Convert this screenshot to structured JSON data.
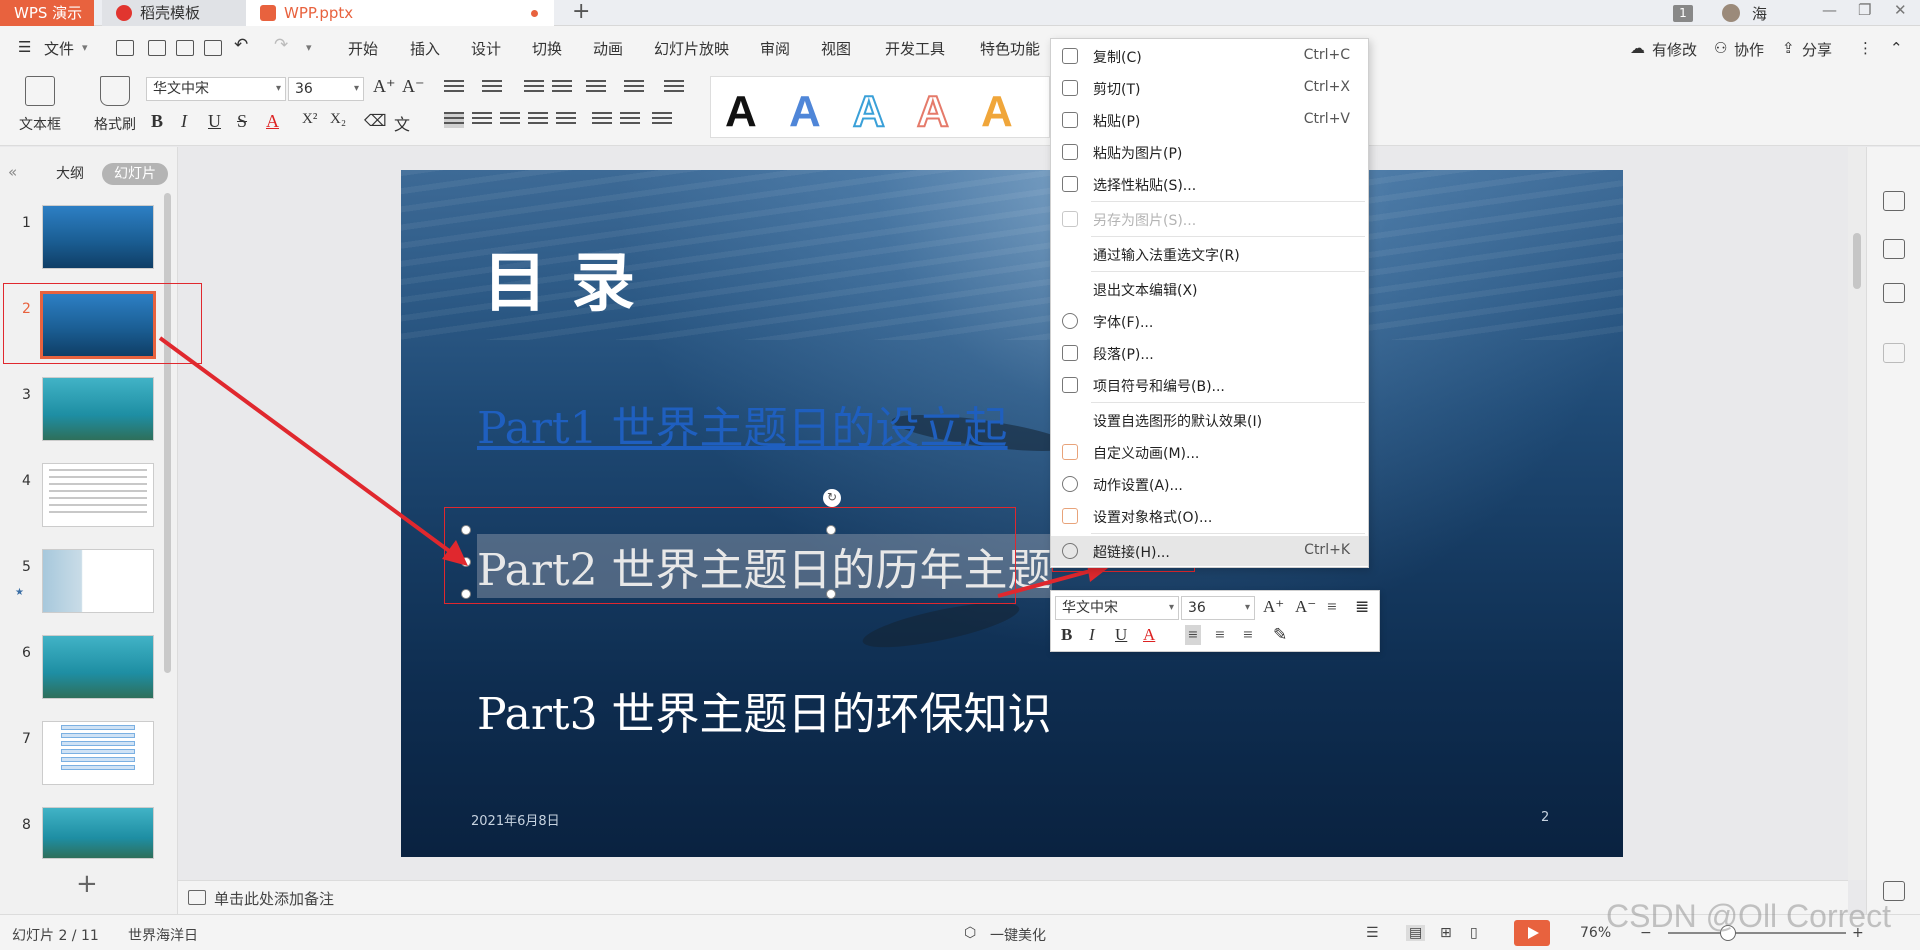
{
  "tabs": {
    "app": "WPS 演示",
    "docer": "稻壳模板",
    "file": "WPP.pptx",
    "add": "+",
    "badge": "1",
    "user": "海"
  },
  "menu": {
    "file": "文件",
    "items": [
      "开始",
      "插入",
      "设计",
      "切换",
      "动画",
      "幻灯片放映",
      "审阅",
      "视图",
      "开发工具",
      "特色功能"
    ],
    "right": [
      "有修改",
      "协作",
      "分享"
    ]
  },
  "ribbon": {
    "textbox": "文本框",
    "format_painter": "格式刷",
    "font": "华文中宋",
    "size": "36",
    "style_letter": "A"
  },
  "left_panel": {
    "tab_outline": "大纲",
    "tab_slides": "幻灯片",
    "slide_numbers": [
      "1",
      "2",
      "3",
      "4",
      "5",
      "6",
      "7",
      "8"
    ],
    "add": "+"
  },
  "slide": {
    "title": "目录",
    "part1": "Part1   世界主题日的设立起",
    "part2": "Part2   世界主题日的历年主题",
    "part3": "Part3   世界主题日的环保知识",
    "date": "2021年6月8日",
    "page": "2"
  },
  "context_menu": [
    {
      "label": "复制(C)",
      "key": "Ctrl+C",
      "icon": "copy-icon",
      "disabled": false
    },
    {
      "label": "剪切(T)",
      "key": "Ctrl+X",
      "icon": "cut-icon",
      "disabled": false
    },
    {
      "label": "粘贴(P)",
      "key": "Ctrl+V",
      "icon": "paste-icon",
      "disabled": false
    },
    {
      "label": "粘贴为图片(P)",
      "key": "",
      "icon": "paste-image-icon",
      "disabled": false
    },
    {
      "label": "选择性粘贴(S)...",
      "key": "",
      "icon": "paste-special-icon",
      "disabled": false
    },
    {
      "label": "另存为图片(S)...",
      "key": "",
      "icon": "save-image-icon",
      "disabled": true
    },
    {
      "label": "通过输入法重选文字(R)",
      "key": "",
      "icon": "",
      "disabled": false
    },
    {
      "label": "退出文本编辑(X)",
      "key": "",
      "icon": "",
      "disabled": false
    },
    {
      "label": "字体(F)...",
      "key": "",
      "icon": "font-icon",
      "disabled": false
    },
    {
      "label": "段落(P)...",
      "key": "",
      "icon": "paragraph-icon",
      "disabled": false
    },
    {
      "label": "项目符号和编号(B)...",
      "key": "",
      "icon": "bullets-icon",
      "disabled": false
    },
    {
      "label": "设置自选图形的默认效果(I)",
      "key": "",
      "icon": "",
      "disabled": false
    },
    {
      "label": "自定义动画(M)...",
      "key": "",
      "icon": "animation-icon",
      "disabled": false
    },
    {
      "label": "动作设置(A)...",
      "key": "",
      "icon": "action-icon",
      "disabled": false
    },
    {
      "label": "设置对象格式(O)...",
      "key": "",
      "icon": "object-format-icon",
      "disabled": false
    },
    {
      "label": "超链接(H)...",
      "key": "Ctrl+K",
      "icon": "hyperlink-icon",
      "disabled": false
    }
  ],
  "mini_toolbar": {
    "font": "华文中宋",
    "size": "36"
  },
  "notes": {
    "placeholder": "单击此处添加备注"
  },
  "status": {
    "slide_info": "幻灯片 2 / 11",
    "theme": "世界海洋日",
    "beautify": "一键美化",
    "zoom": "76%",
    "zoom_level": 0.76
  },
  "watermark": "CSDN @Oll Correct",
  "colors": {
    "accent": "#e8623e",
    "annotation": "#e0282e",
    "hyperlink": "#1f5fbf"
  }
}
